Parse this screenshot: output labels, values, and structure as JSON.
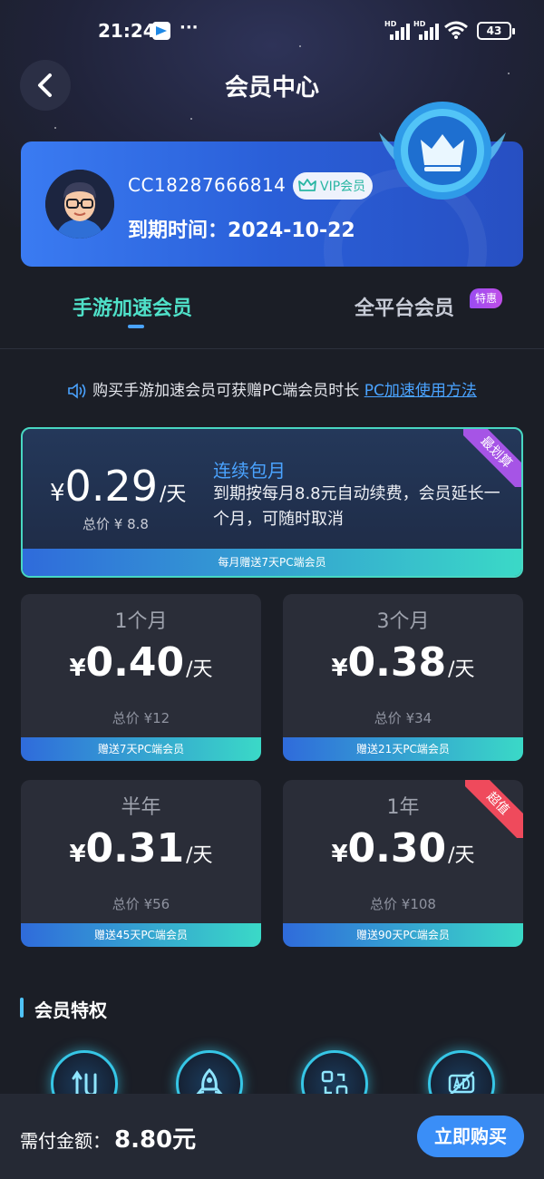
{
  "status_bar": {
    "time": "21:24",
    "dots": "···",
    "hd1": "HD",
    "hd2": "HD",
    "battery": "43"
  },
  "header": {
    "title": "会员中心"
  },
  "member": {
    "user_id": "CC18287666814",
    "vip_label": "VIP会员",
    "expiry_label": "到期时间：",
    "expiry_date": "2024-10-22"
  },
  "tabs": [
    {
      "label": "手游加速会员",
      "active": true
    },
    {
      "label": "全平台会员",
      "badge": "特惠",
      "active": false
    }
  ],
  "notice": {
    "text": "购买手游加速会员可获赠PC端会员时长",
    "link": "PC加速使用方法"
  },
  "featured_plan": {
    "ribbon": "最划算",
    "yen": "¥",
    "price": "0.29",
    "unit": "/天",
    "total": "总价 ¥ 8.8",
    "name": "连续包月",
    "desc": "到期按每月8.8元自动续费，会员延长一个月，可随时取消",
    "gift": "每月赠送7天PC端会员"
  },
  "plans": [
    {
      "period": "1个月",
      "yen": "¥",
      "price": "0.40",
      "unit": "/天",
      "total": "总价 ¥12",
      "gift": "赠送7天PC端会员"
    },
    {
      "period": "3个月",
      "yen": "¥",
      "price": "0.38",
      "unit": "/天",
      "total": "总价 ¥34",
      "gift": "赠送21天PC端会员"
    },
    {
      "period": "半年",
      "yen": "¥",
      "price": "0.31",
      "unit": "/天",
      "total": "总价 ¥56",
      "gift": "赠送45天PC端会员"
    },
    {
      "period": "1年",
      "yen": "¥",
      "price": "0.30",
      "unit": "/天",
      "total": "总价 ¥108",
      "gift": "赠送90天PC端会员",
      "ribbon": "超值"
    }
  ],
  "privileges": {
    "title": "会员特权",
    "icons": [
      "speed-icon",
      "rocket-icon",
      "switch-icon",
      "ad-free-icon"
    ]
  },
  "footer": {
    "pay_label": "需付金额：",
    "pay_amount": "8.80元",
    "buy_label": "立即购买"
  },
  "colors": {
    "accent": "#3a8ef7",
    "teal": "#4fe0c8",
    "card_bg": "#2a2d38",
    "page_bg": "#1b1e26"
  }
}
